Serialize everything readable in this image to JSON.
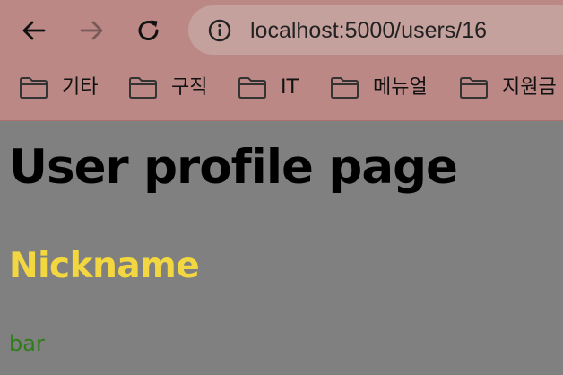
{
  "browser": {
    "url": "localhost:5000/users/16",
    "nav_icons": [
      "back-arrow-icon",
      "forward-arrow-icon",
      "reload-icon",
      "info-icon"
    ],
    "bookmarks": [
      {
        "label": "기타",
        "icon": "folder-icon"
      },
      {
        "label": "구직",
        "icon": "folder-icon"
      },
      {
        "label": "IT",
        "icon": "folder-icon"
      },
      {
        "label": "메뉴얼",
        "icon": "folder-icon"
      },
      {
        "label": "지원금",
        "icon": "folder-icon"
      }
    ],
    "colors": {
      "chrome_bg": "#bb8885",
      "address_bar_bg": "#c5a19e"
    }
  },
  "page": {
    "title": "User profile page",
    "nickname_heading": "Nickname",
    "nickname_value": "bar",
    "colors": {
      "background": "#808080",
      "heading_color": "#f3d740",
      "value_color": "#2f7d1a"
    }
  }
}
